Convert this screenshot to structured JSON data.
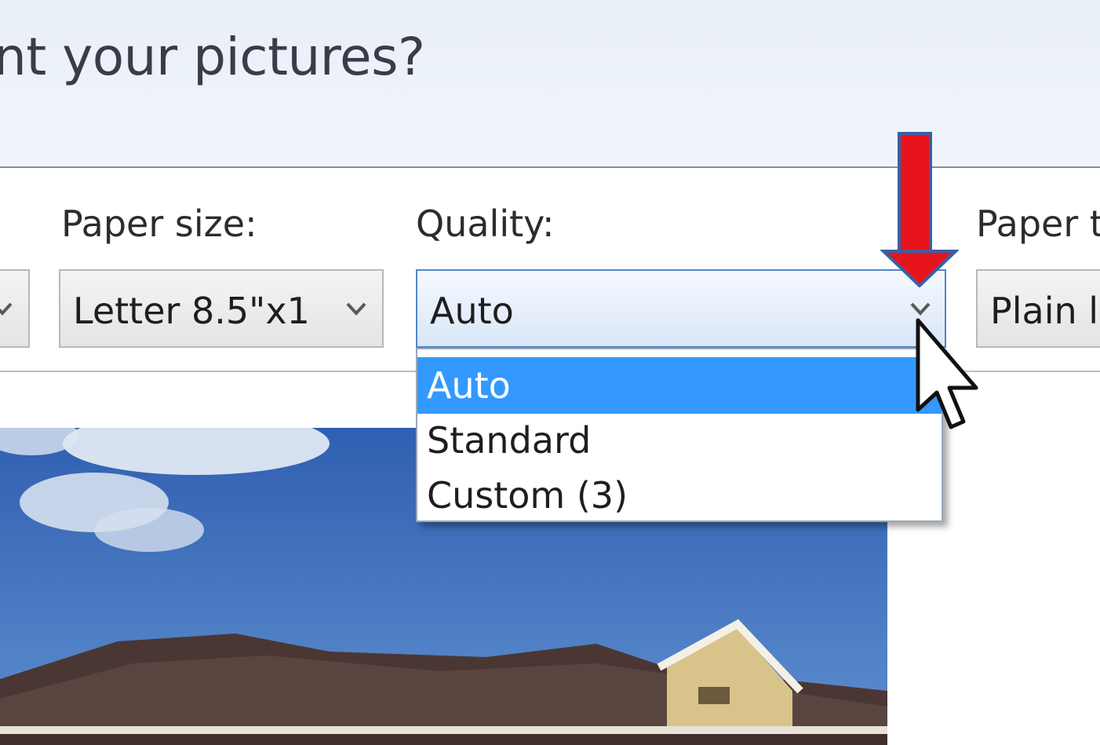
{
  "window": {
    "title": "nt your pictures?"
  },
  "print_options": {
    "paper_size": {
      "label": "Paper size:",
      "value": "Letter 8.5\"x1"
    },
    "quality": {
      "label": "Quality:",
      "value": "Auto",
      "options": [
        "Auto",
        "Standard",
        "Custom (3)"
      ],
      "highlighted_index": 0
    },
    "paper_type": {
      "label": "Paper t",
      "value": "Plain l"
    }
  },
  "annotation": {
    "arrow_color": "#e8141b"
  },
  "colors": {
    "highlight": "#3399ff",
    "active_border": "#4f87c8",
    "header_background": "#e9eff8"
  },
  "icons": [
    "chevron-down-icon",
    "mouse-pointer-icon",
    "red-arrow-icon"
  ]
}
